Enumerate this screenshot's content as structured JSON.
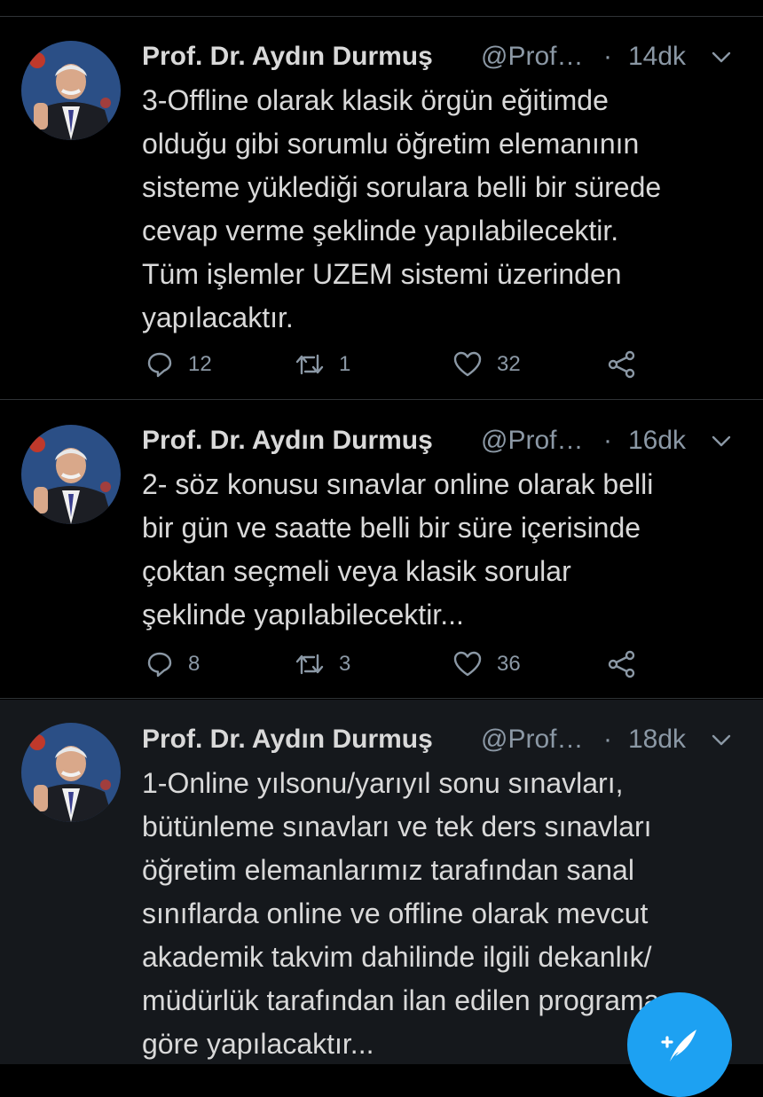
{
  "colors": {
    "background": "#000000",
    "selected_background": "#15181c",
    "text": "#d9d9d9",
    "secondary_text": "#8b98a5",
    "divider": "#2f3336",
    "accent": "#1da1f2"
  },
  "tweets": [
    {
      "author_name": "Prof. Dr. Aydın Durmuş",
      "handle": "@Prof…",
      "separator": "·",
      "time": "14dk",
      "text": "3-Offline olarak klasik örgün eğitimde\nolduğu gibi sorumlu öğretim elemanının\nsisteme yüklediği sorulara belli bir sürede\ncevap verme şeklinde yapılabilecektir.\nTüm işlemler UZEM sistemi üzerinden\nyapılacaktır.",
      "reply_count": "12",
      "retweet_count": "1",
      "like_count": "32"
    },
    {
      "author_name": "Prof. Dr. Aydın Durmuş",
      "handle": "@Prof…",
      "separator": "·",
      "time": "16dk",
      "text": "2- söz konusu sınavlar online olarak belli\nbir gün ve saatte belli bir süre içerisinde\nçoktan seçmeli veya klasik sorular\nşeklinde yapılabilecektir...",
      "reply_count": "8",
      "retweet_count": "3",
      "like_count": "36"
    },
    {
      "author_name": "Prof. Dr. Aydın Durmuş",
      "handle": "@Prof…",
      "separator": "·",
      "time": "18dk",
      "text": "1-Online yılsonu/yarıyıl sonu sınavları,\nbütünleme sınavları ve tek ders sınavları\nöğretim elemanlarımız tarafından sanal\nsınıflarda online ve offline olarak mevcut\nakademik takvim dahilinde ilgili dekanlık/\nmüdürlük tarafından ilan edilen programa\ngöre yapılacaktır..."
    }
  ],
  "icons": {
    "reply": "reply-icon",
    "retweet": "retweet-icon",
    "like": "heart-icon",
    "share": "share-icon",
    "more": "chevron-down-icon",
    "compose": "compose-tweet-icon"
  }
}
